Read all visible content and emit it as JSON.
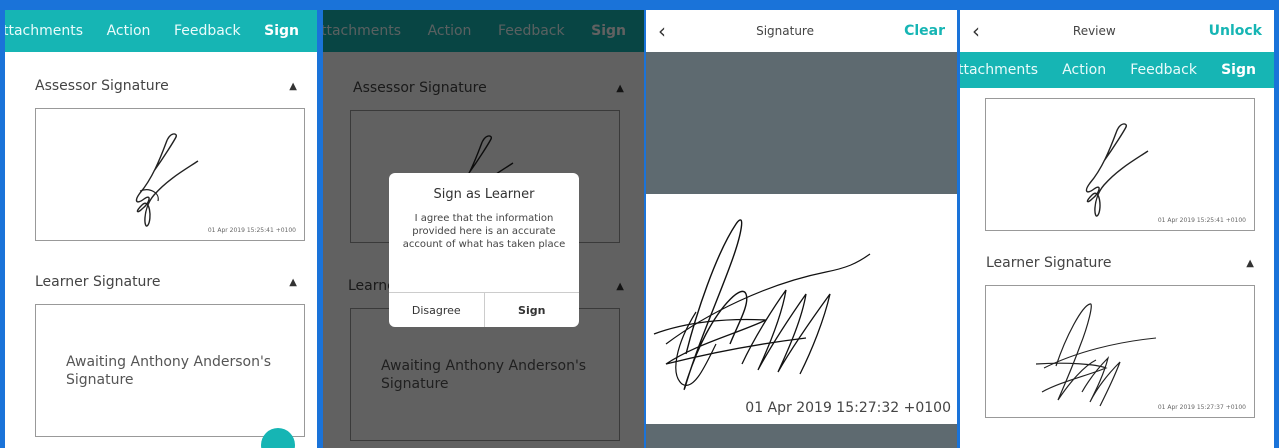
{
  "tabs": [
    "ttachments",
    "Action",
    "Feedback",
    "Sign"
  ],
  "tabs_p4": [
    "ttachments",
    "Action",
    "Feedback",
    "Sign"
  ],
  "assessor_label": "Assessor Signature",
  "learner_label": "Learner Signature",
  "assessor_stamp": "01 Apr 2019 15:25:41 +0100",
  "awaiting_text": "Awaiting Anthony Anderson's Signature",
  "dialog": {
    "title": "Sign as Learner",
    "body": "I agree that the information provided here is an accurate account of what has taken place",
    "disagree": "Disagree",
    "sign": "Sign"
  },
  "signature_screen": {
    "title": "Signature",
    "clear": "Clear",
    "stamp": "01 Apr 2019 15:27:32 +0100"
  },
  "review_screen": {
    "title": "Review",
    "unlock": "Unlock",
    "learner_stamp": "01 Apr 2019 15:27:37 +0100"
  },
  "colors": {
    "accent": "#16b5b4",
    "frame": "#1a73d9"
  }
}
